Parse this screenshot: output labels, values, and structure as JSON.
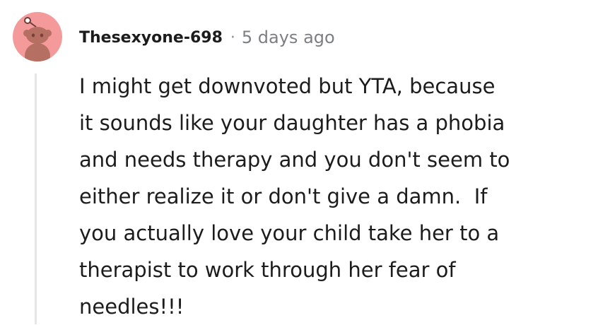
{
  "comment": {
    "author": {
      "username": "Thesexyone-698",
      "avatar_icon": "snoo-avatar-icon",
      "avatar_color": "#f49a9a"
    },
    "separator": "·",
    "timestamp": "5 days ago",
    "body": "I might get downvoted but YTA, because\nit sounds like your daughter has a phobia\nand needs therapy and you don't seem to\neither realize it or don't give a damn.  If\nyou actually love your child take her to a\ntherapist to work through her fear of\nneedles!!!"
  }
}
